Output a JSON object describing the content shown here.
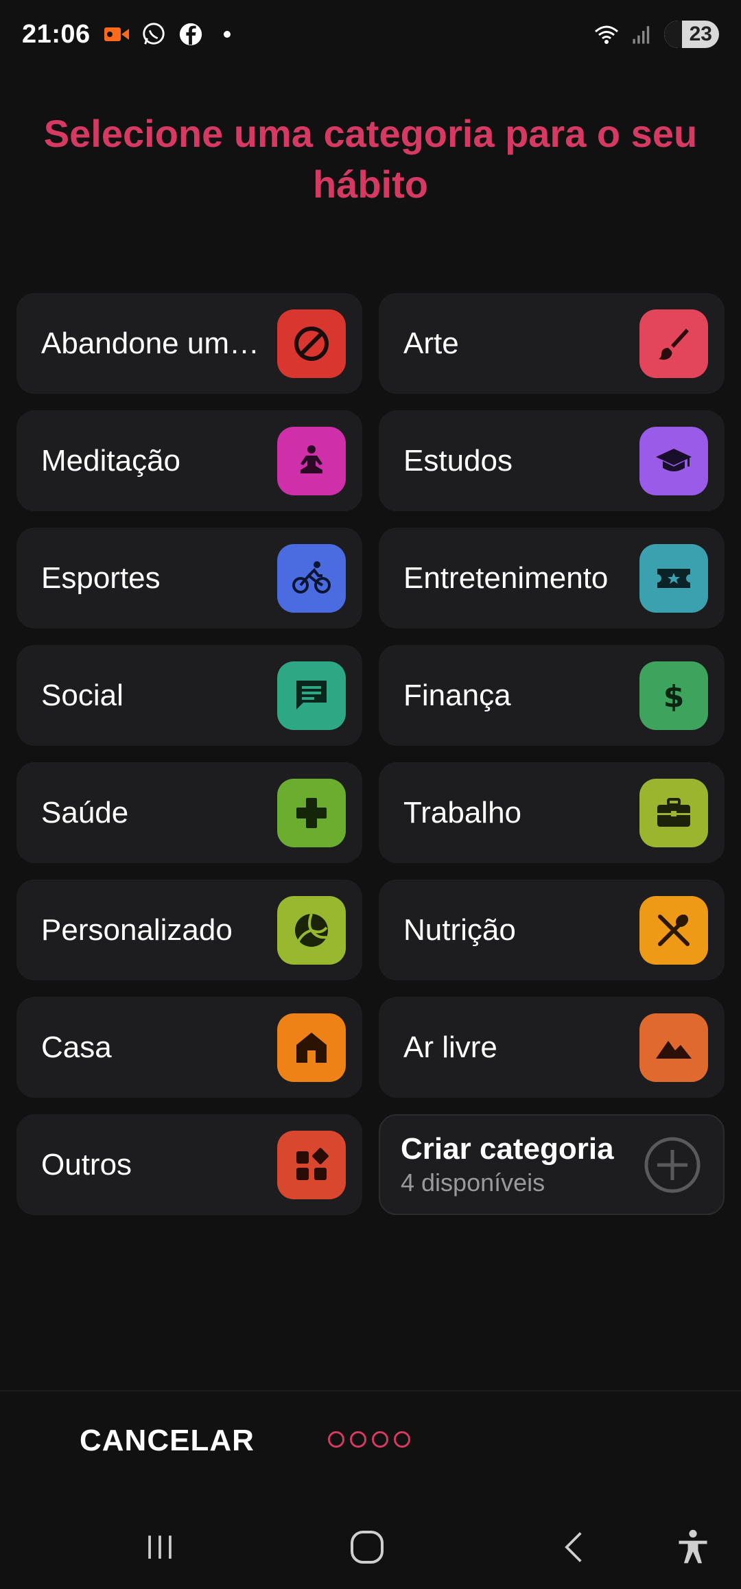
{
  "status_bar": {
    "time": "21:06",
    "battery": "23",
    "icons": [
      "video-recording-icon",
      "whatsapp-icon",
      "facebook-icon",
      "dot-icon",
      "wifi-icon",
      "signal-icon",
      "battery-icon"
    ]
  },
  "title": "Selecione uma categoria para o seu hábito",
  "categories": [
    {
      "label": "Abandone um hábito ruim",
      "icon": "block-icon",
      "color": "#d8362f"
    },
    {
      "label": "Arte",
      "icon": "brush-icon",
      "color": "#e3465a"
    },
    {
      "label": "Meditação",
      "icon": "meditation-icon",
      "color": "#cf2fa9"
    },
    {
      "label": "Estudos",
      "icon": "graduation-cap-icon",
      "color": "#9a5be8"
    },
    {
      "label": "Esportes",
      "icon": "bicycle-icon",
      "color": "#4a6ce0"
    },
    {
      "label": "Entretenimento",
      "icon": "ticket-icon",
      "color": "#3ba1ae"
    },
    {
      "label": "Social",
      "icon": "chat-icon",
      "color": "#2ea785"
    },
    {
      "label": "Finança",
      "icon": "dollar-icon",
      "color": "#3ea35c"
    },
    {
      "label": "Saúde",
      "icon": "plus-cross-icon",
      "color": "#6aad2f"
    },
    {
      "label": "Trabalho",
      "icon": "briefcase-icon",
      "color": "#9cb52f"
    },
    {
      "label": "Personalizado",
      "icon": "ball-icon",
      "color": "#97b82f"
    },
    {
      "label": "Nutrição",
      "icon": "utensils-icon",
      "color": "#ef9a16"
    },
    {
      "label": "Casa",
      "icon": "home-icon",
      "color": "#ef8216"
    },
    {
      "label": "Ar livre",
      "icon": "mountain-icon",
      "color": "#e06a2d"
    },
    {
      "label": "Outros",
      "icon": "apps-icon",
      "color": "#d9472f"
    }
  ],
  "create_category": {
    "title": "Criar categoria",
    "subtitle": "4 disponíveis",
    "icon": "plus-circle-icon"
  },
  "footer": {
    "cancel_label": "CANCELAR",
    "steps_total": 4
  },
  "accent_color": "#d63a63",
  "nav_bar": [
    "recent-apps-icon",
    "home-icon",
    "back-icon",
    "accessibility-icon"
  ]
}
